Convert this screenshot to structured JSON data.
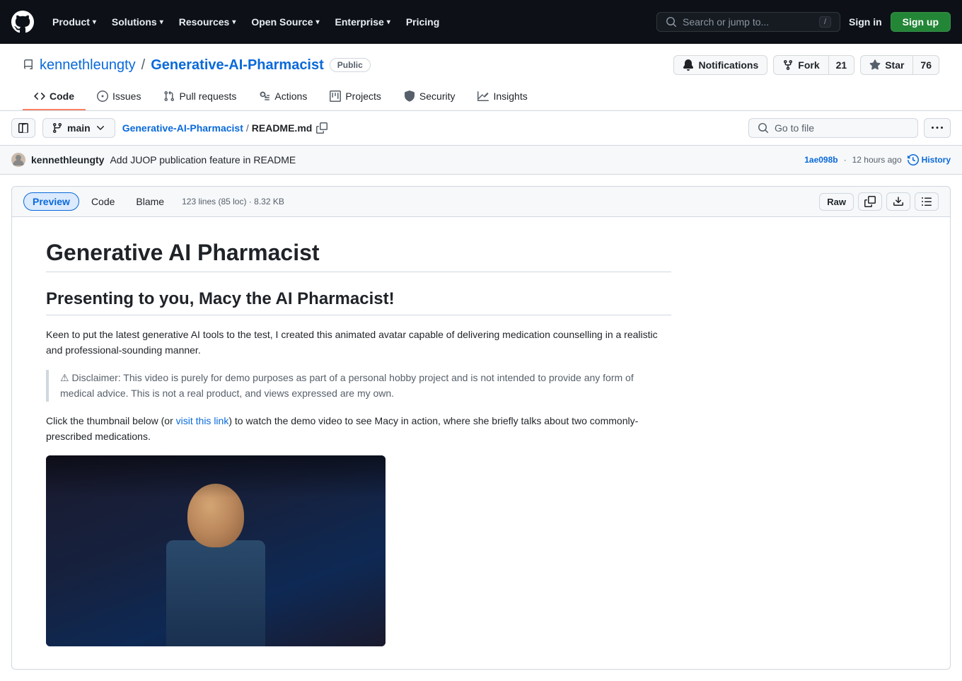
{
  "nav": {
    "logo": "⬛",
    "items": [
      {
        "label": "Product",
        "has_chevron": true
      },
      {
        "label": "Solutions",
        "has_chevron": true
      },
      {
        "label": "Resources",
        "has_chevron": true
      },
      {
        "label": "Open Source",
        "has_chevron": true
      },
      {
        "label": "Enterprise",
        "has_chevron": true
      },
      {
        "label": "Pricing",
        "has_chevron": false
      }
    ],
    "search_placeholder": "Search or jump to...",
    "search_kbd": "/",
    "sign_in": "Sign in",
    "sign_up": "Sign up"
  },
  "repo": {
    "owner": "kennethleungty",
    "name": "Generative-AI-Pharmacist",
    "visibility": "Public",
    "notifications_label": "Notifications",
    "fork_label": "Fork",
    "fork_count": "21",
    "star_label": "Star",
    "star_count": "76"
  },
  "tabs": [
    {
      "id": "code",
      "label": "Code",
      "icon": "<>"
    },
    {
      "id": "issues",
      "label": "Issues",
      "icon": "○"
    },
    {
      "id": "pull-requests",
      "label": "Pull requests",
      "icon": "⑂"
    },
    {
      "id": "actions",
      "label": "Actions",
      "icon": "▶"
    },
    {
      "id": "projects",
      "label": "Projects",
      "icon": "▦"
    },
    {
      "id": "security",
      "label": "Security",
      "icon": "🛡"
    },
    {
      "id": "insights",
      "label": "Insights",
      "icon": "📈"
    }
  ],
  "file_bar": {
    "branch": "main",
    "repo_breadcrumb": "Generative-AI-Pharmacist",
    "file_breadcrumb": "README.md",
    "goto_placeholder": "Go to file"
  },
  "commit": {
    "author": "kennethleungty",
    "message": "Add JUOP publication feature in README",
    "sha": "1ae098b",
    "time_ago": "12 hours ago",
    "history_label": "History"
  },
  "file_view": {
    "tabs": [
      "Preview",
      "Code",
      "Blame"
    ],
    "active_tab": "Preview",
    "meta": "123 lines (85 loc) · 8.32 KB",
    "actions": [
      "Raw",
      "📋",
      "⬇",
      "☰"
    ]
  },
  "markdown": {
    "h1": "Generative AI Pharmacist",
    "h2": "Presenting to you, Macy the AI Pharmacist!",
    "intro": "Keen to put the latest generative AI tools to the test, I created this animated avatar capable of delivering medication counselling in a realistic and professional-sounding manner.",
    "disclaimer": "⚠ Disclaimer: This video is purely for demo purposes as part of a personal hobby project and is not intended to provide any form of medical advice. This is not a real product, and views expressed are my own.",
    "link_text": "visit this link",
    "click_text_before": "Click the thumbnail below (or ",
    "click_text_after": ") to watch the demo video to see Macy in action, where she briefly talks about two commonly-prescribed medications."
  }
}
